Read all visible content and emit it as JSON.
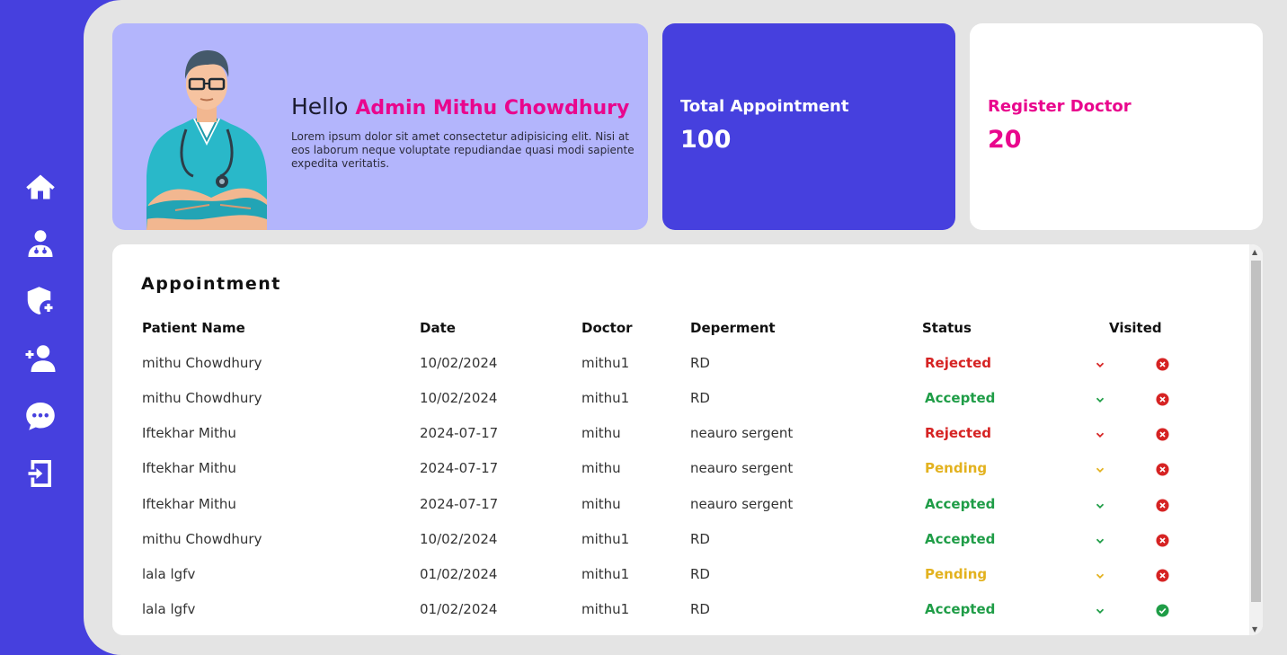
{
  "sidebar": {
    "items": [
      {
        "icon": "home-icon"
      },
      {
        "icon": "doctor-icon"
      },
      {
        "icon": "shield-plus-icon"
      },
      {
        "icon": "add-user-icon"
      },
      {
        "icon": "chat-icon"
      },
      {
        "icon": "logout-icon"
      }
    ]
  },
  "welcome": {
    "greeting": "Hello",
    "name": "Admin Mithu Chowdhury",
    "description": "Lorem ipsum dolor sit amet consectetur adipisicing elit. Nisi at eos laborum neque voluptate repudiandae quasi modi sapiente expedita veritatis."
  },
  "stats": {
    "total_appointment": {
      "label": "Total Appointment",
      "value": "100"
    },
    "register_doctor": {
      "label": "Register Doctor",
      "value": "20"
    }
  },
  "appointments": {
    "title": "Appointment",
    "columns": {
      "patient": "Patient Name",
      "date": "Date",
      "doctor": "Doctor",
      "department": "Deperment",
      "status": "Status",
      "visited": "Visited"
    },
    "rows": [
      {
        "patient": "mithu Chowdhury",
        "date": "10/02/2024",
        "doctor": "mithu1",
        "department": "RD",
        "status": "Rejected",
        "visited": false
      },
      {
        "patient": "mithu Chowdhury",
        "date": "10/02/2024",
        "doctor": "mithu1",
        "department": "RD",
        "status": "Accepted",
        "visited": false
      },
      {
        "patient": "Iftekhar Mithu",
        "date": "2024-07-17",
        "doctor": "mithu",
        "department": "neauro sergent",
        "status": "Rejected",
        "visited": false
      },
      {
        "patient": "Iftekhar Mithu",
        "date": "2024-07-17",
        "doctor": "mithu",
        "department": "neauro sergent",
        "status": "Pending",
        "visited": false
      },
      {
        "patient": "Iftekhar Mithu",
        "date": "2024-07-17",
        "doctor": "mithu",
        "department": "neauro sergent",
        "status": "Accepted",
        "visited": false
      },
      {
        "patient": "mithu Chowdhury",
        "date": "10/02/2024",
        "doctor": "mithu1",
        "department": "RD",
        "status": "Accepted",
        "visited": false
      },
      {
        "patient": "lala lgfv",
        "date": "01/02/2024",
        "doctor": "mithu1",
        "department": "RD",
        "status": "Pending",
        "visited": false
      },
      {
        "patient": "lala lgfv",
        "date": "01/02/2024",
        "doctor": "mithu1",
        "department": "RD",
        "status": "Accepted",
        "visited": true
      }
    ]
  },
  "colors": {
    "brand": "#4640de",
    "accent_pink": "#e9068d",
    "card_lavender": "#b3b5fc",
    "rejected": "#d62323",
    "accepted": "#1f9d47",
    "pending": "#e3b21f"
  }
}
